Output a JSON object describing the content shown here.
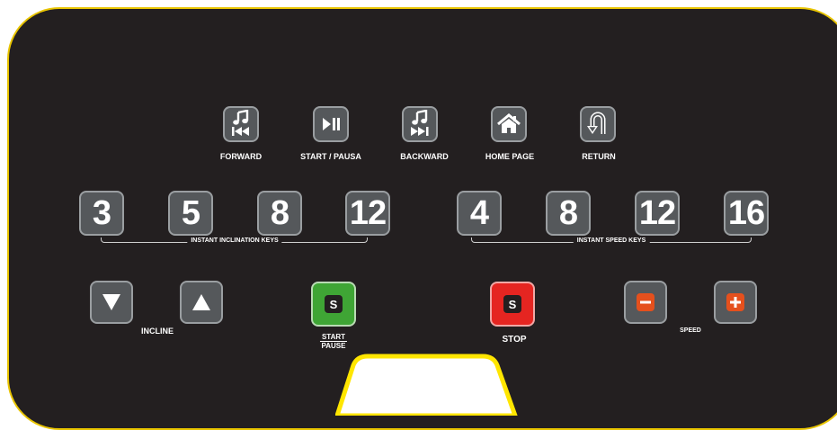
{
  "nav_buttons": [
    {
      "label": "FORWARD",
      "icon": "music-note-previous-icon"
    },
    {
      "label": "START / PAUSA",
      "icon": "play-pause-icon"
    },
    {
      "label": "BACKWARD",
      "icon": "music-note-next-icon"
    },
    {
      "label": "HOME PAGE",
      "icon": "home-icon"
    },
    {
      "label": "RETURN",
      "icon": "u-turn-arrow-icon"
    }
  ],
  "incline_keys": {
    "values": [
      "3",
      "5",
      "8",
      "12"
    ],
    "group_label": "INSTANT INCLINATION KEYS"
  },
  "speed_keys": {
    "values": [
      "4",
      "8",
      "12",
      "16"
    ],
    "group_label": "INSTANT SPEED KEYS"
  },
  "incline_control": {
    "label": "INCLINE",
    "down_icon": "triangle-down-icon",
    "up_icon": "triangle-up-icon"
  },
  "start_pause": {
    "badge": "S",
    "label_top": "START",
    "label_bottom": "PAUSE",
    "color": "#3fa535"
  },
  "stop": {
    "badge": "S",
    "label": "STOP",
    "color": "#e52521"
  },
  "speed_control": {
    "label": "SPEED",
    "minus_icon": "minus-icon",
    "plus_icon": "plus-icon",
    "accent": "#e5501d"
  },
  "colors": {
    "panel": "#231f20",
    "border": "#e8c400",
    "button": "#55585b"
  }
}
